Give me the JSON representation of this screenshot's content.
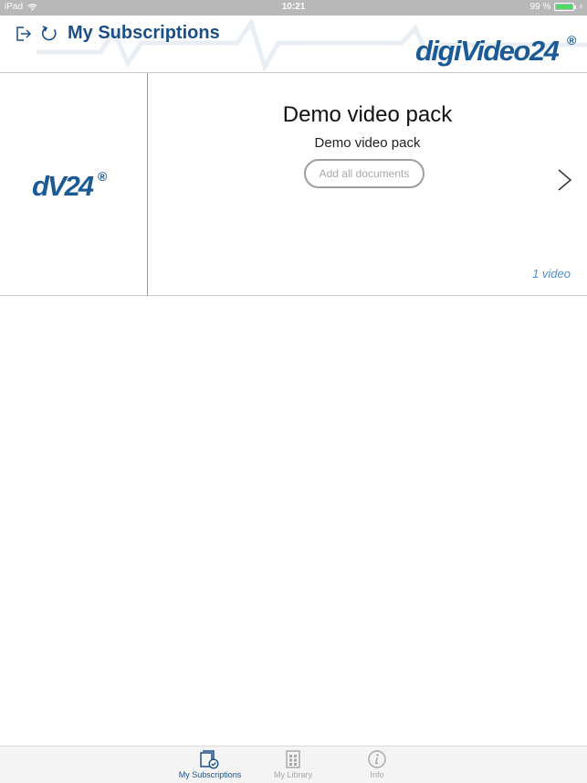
{
  "status_bar": {
    "device": "iPad",
    "time": "10:21",
    "battery": "99 %",
    "battery_level": 0.99
  },
  "header": {
    "title": "My Subscriptions",
    "brand": "digiVideo24",
    "brand_mark": "®",
    "icons": [
      "logout-icon",
      "refresh-icon"
    ]
  },
  "subscription": {
    "thumbnail_logo": "dV24",
    "thumbnail_mark": "®",
    "title": "Demo video pack",
    "subtitle": "Demo video pack",
    "add_all_label": "Add all documents",
    "count": "1 video"
  },
  "tabbar": {
    "tabs": [
      {
        "label": "My Subscriptions",
        "icon": "subscriptions-icon",
        "active": true
      },
      {
        "label": "My Library",
        "icon": "library-icon",
        "active": false
      },
      {
        "label": "Info",
        "icon": "info-icon",
        "active": false
      }
    ]
  },
  "colors": {
    "accent": "#1b4f86",
    "link": "#4a8fd6",
    "status_bg": "#b8b8b8",
    "battery": "#4cd964"
  }
}
